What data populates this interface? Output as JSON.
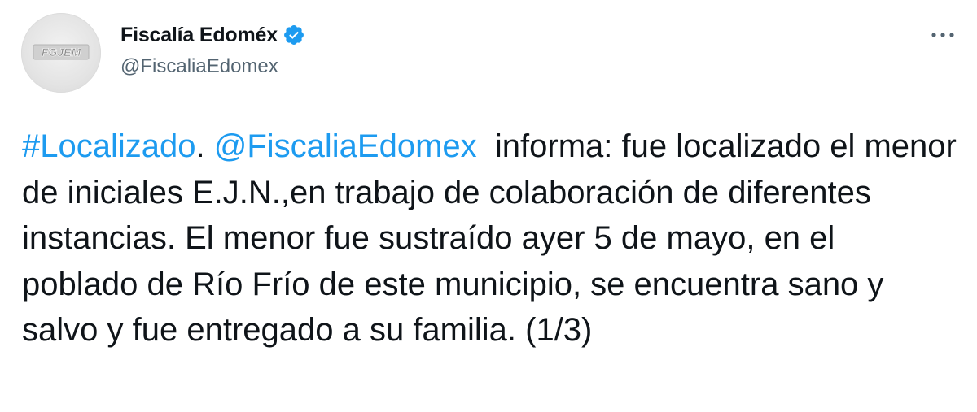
{
  "author": {
    "display_name": "Fiscalía Edoméx",
    "handle": "@FiscaliaEdomex",
    "verified": true,
    "avatar_text": "FGJEM"
  },
  "menu": {
    "icon": "more-horizontal-icon"
  },
  "tweet": {
    "hashtag": "#Localizado",
    "after_hashtag": ". ",
    "mention": "@FiscaliaEdomex",
    "body": "  informa: fue localizado el menor de iniciales E.J.N.,en trabajo de colaboración de diferentes instancias. El menor fue sustraído ayer 5 de mayo, en el poblado de Río Frío de este municipio, se encuentra sano y salvo y fue entregado a su familia. (1/3)"
  },
  "colors": {
    "link": "#1d9bf0",
    "text": "#0f1419",
    "secondary": "#536471",
    "verified_badge": "#1d9bf0"
  }
}
